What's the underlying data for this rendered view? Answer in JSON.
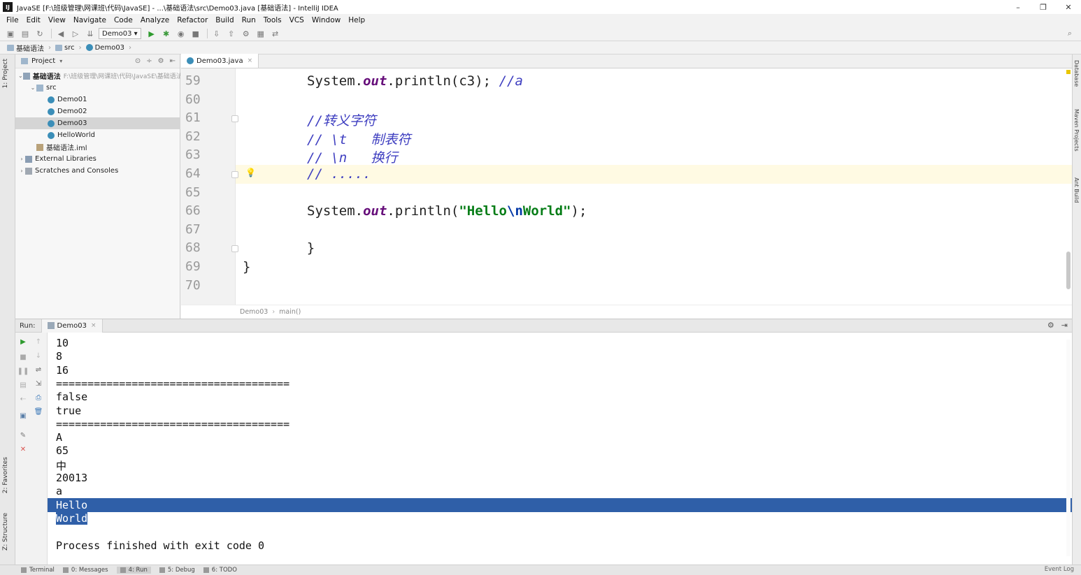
{
  "window": {
    "title": "JavaSE [F:\\班级管理\\网课班\\代码\\JavaSE] - ...\\基础语法\\src\\Demo03.java [基础语法] - IntelliJ IDEA",
    "minimize": "–",
    "maximize": "❐",
    "close": "✕"
  },
  "menu": [
    "File",
    "Edit",
    "View",
    "Navigate",
    "Code",
    "Analyze",
    "Refactor",
    "Build",
    "Run",
    "Tools",
    "VCS",
    "Window",
    "Help"
  ],
  "toolbar": {
    "run_config": "Demo03",
    "search_icon": "search-icon"
  },
  "breadcrumb": [
    "基础语法",
    "src",
    "Demo03"
  ],
  "left_tabs": {
    "project": "1: Project",
    "favorites": "2: Favorites",
    "structure": "Z: Structure"
  },
  "right_tabs": {
    "database": "Database",
    "maven": "Maven Projects",
    "ant": "Ant Build"
  },
  "project_panel": {
    "title": "Project",
    "tree": [
      {
        "label": "基础语法",
        "extra": "F:\\班级管理\\网课班\\代码\\JavaSE\\基础语法",
        "depth": 0,
        "arrow": "⌄",
        "icon": "module-icon"
      },
      {
        "label": "src",
        "extra": "",
        "depth": 1,
        "arrow": "⌄",
        "icon": "folder-icon"
      },
      {
        "label": "Demo01",
        "extra": "",
        "depth": 2,
        "arrow": "",
        "icon": "class-icon"
      },
      {
        "label": "Demo02",
        "extra": "",
        "depth": 2,
        "arrow": "",
        "icon": "class-icon"
      },
      {
        "label": "Demo03",
        "extra": "",
        "depth": 2,
        "arrow": "",
        "icon": "class-icon",
        "selected": true
      },
      {
        "label": "HelloWorld",
        "extra": "",
        "depth": 2,
        "arrow": "",
        "icon": "class-icon"
      },
      {
        "label": "基础语法.iml",
        "extra": "",
        "depth": 1,
        "arrow": "",
        "icon": "iml-file-icon"
      },
      {
        "label": "External Libraries",
        "extra": "",
        "depth": 0,
        "arrow": "›",
        "icon": "library-icon"
      },
      {
        "label": "Scratches and Consoles",
        "extra": "",
        "depth": 0,
        "arrow": "›",
        "icon": "scratches-icon"
      }
    ]
  },
  "editor": {
    "tab_label": "Demo03.java",
    "tab_close": "×",
    "lines": [
      {
        "num": "59",
        "segs": [
          [
            "plain",
            "System."
          ],
          [
            "kw-out",
            "out"
          ],
          [
            "plain",
            ".println(c3); "
          ],
          [
            "cm",
            "//a"
          ]
        ]
      },
      {
        "num": "60",
        "segs": []
      },
      {
        "num": "61",
        "segs": [
          [
            "cm",
            "//转义字符"
          ]
        ]
      },
      {
        "num": "62",
        "segs": [
          [
            "cm",
            "// \\t   制表符"
          ]
        ]
      },
      {
        "num": "63",
        "segs": [
          [
            "cm",
            "// \\n   换行"
          ]
        ]
      },
      {
        "num": "64",
        "segs": [
          [
            "cm",
            "// ....."
          ]
        ],
        "highlight": true
      },
      {
        "num": "65",
        "segs": []
      },
      {
        "num": "66",
        "segs": [
          [
            "plain",
            "System."
          ],
          [
            "kw-out",
            "out"
          ],
          [
            "plain",
            ".println("
          ],
          [
            "str",
            "\"Hello"
          ],
          [
            "esc",
            "\\n"
          ],
          [
            "str",
            "World\""
          ],
          [
            "plain",
            ");"
          ]
        ]
      },
      {
        "num": "67",
        "segs": []
      },
      {
        "num": "68",
        "segs": [
          [
            "plain",
            "    }"
          ]
        ],
        "indent": -4
      },
      {
        "num": "69",
        "segs": [
          [
            "plain",
            "}"
          ]
        ],
        "indent": -8
      },
      {
        "num": "70",
        "segs": []
      }
    ],
    "breadcrumb": [
      "Demo03",
      "main()"
    ]
  },
  "run_panel": {
    "label": "Run:",
    "tab": "Demo03",
    "tab_close": "×",
    "output": [
      "10",
      "8",
      "16",
      "=====================================",
      "false",
      "true",
      "=====================================",
      "A",
      "65",
      "中",
      "20013",
      "a",
      "Hello",
      "World",
      "",
      "Process finished with exit code 0"
    ],
    "selected_lines": [
      "Hello",
      "World"
    ]
  },
  "statusbar": {
    "tabs": [
      "Terminal",
      "0: Messages",
      "4: Run",
      "5: Debug",
      "6: TODO"
    ],
    "active": "4: Run",
    "right": "Event Log"
  },
  "colors": {
    "comment": "#3e3ec0",
    "string": "#067d17",
    "selection": "#2f5fa8",
    "caret_row": "#fffae3"
  }
}
